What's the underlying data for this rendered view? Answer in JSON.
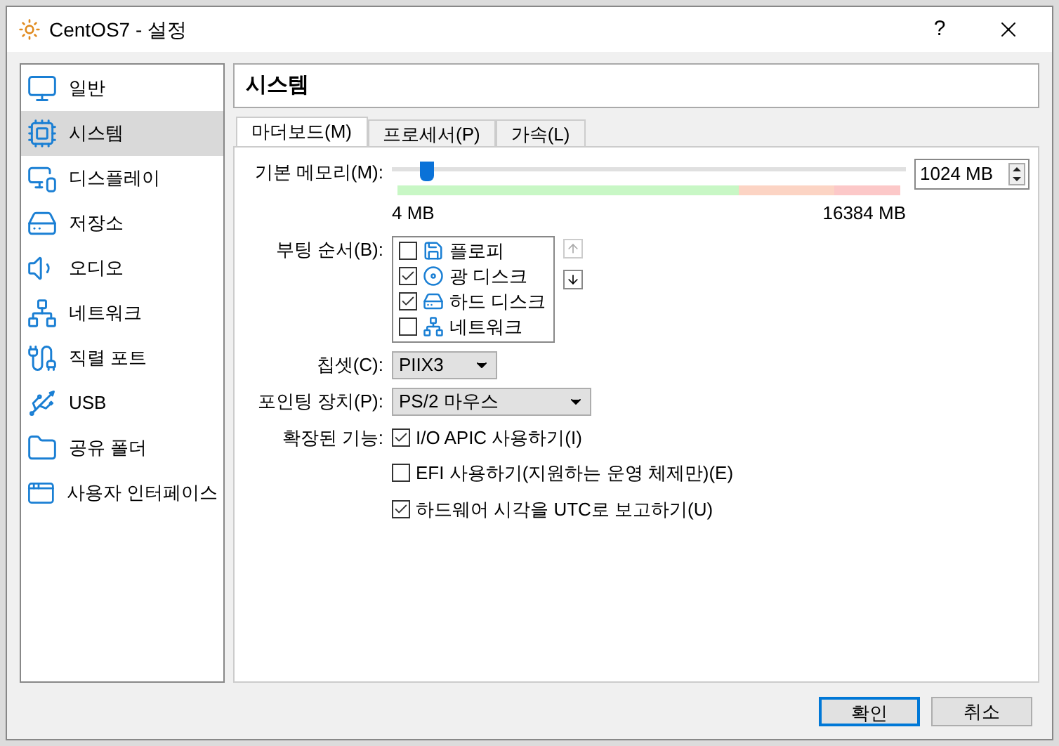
{
  "window": {
    "title": "CentOS7 - 설정",
    "help": "?"
  },
  "sidebar": {
    "items": [
      {
        "kind": "general",
        "label": "일반",
        "selected": false
      },
      {
        "kind": "system",
        "label": "시스템",
        "selected": true
      },
      {
        "kind": "display",
        "label": "디스플레이",
        "selected": false
      },
      {
        "kind": "storage",
        "label": "저장소",
        "selected": false
      },
      {
        "kind": "audio",
        "label": "오디오",
        "selected": false
      },
      {
        "kind": "network",
        "label": "네트워크",
        "selected": false
      },
      {
        "kind": "serial",
        "label": "직렬 포트",
        "selected": false
      },
      {
        "kind": "usb",
        "label": "USB",
        "selected": false
      },
      {
        "kind": "shared",
        "label": "공유 폴더",
        "selected": false
      },
      {
        "kind": "ui",
        "label": "사용자 인터페이스",
        "selected": false
      }
    ]
  },
  "page_title": "시스템",
  "tabs": [
    {
      "label": "마더보드(M)",
      "selected": true
    },
    {
      "label": "프로세서(P)",
      "selected": false
    },
    {
      "label": "가속(L)",
      "selected": false
    }
  ],
  "memory": {
    "label": "기본 메모리(M):",
    "level": 0.068,
    "value": "1024 MB",
    "min_label": "4 MB",
    "max_label": "16384 MB"
  },
  "boot_order": {
    "label": "부팅 순서(B):",
    "items": [
      {
        "kind": "floppy",
        "label": "플로피",
        "checked": false
      },
      {
        "kind": "optical",
        "label": "광 디스크",
        "checked": true
      },
      {
        "kind": "hdd",
        "label": "하드 디스크",
        "checked": true
      },
      {
        "kind": "network",
        "label": "네트워크",
        "checked": false
      }
    ]
  },
  "chipset": {
    "label": "칩셋(C):",
    "value": "PIIX3"
  },
  "pointing": {
    "label": "포인팅 장치(P):",
    "value": "PS/2 마우스"
  },
  "extended": {
    "label": "확장된 기능:",
    "options": [
      {
        "label": "I/O APIC 사용하기(I)",
        "checked": true
      },
      {
        "label": "EFI 사용하기(지원하는 운영 체제만)(E)",
        "checked": false
      },
      {
        "label": "하드웨어 시각을 UTC로 보고하기(U)",
        "checked": true
      }
    ]
  },
  "buttons": [
    {
      "label": "확인",
      "selected": true
    },
    {
      "label": "취소",
      "selected": false
    }
  ]
}
